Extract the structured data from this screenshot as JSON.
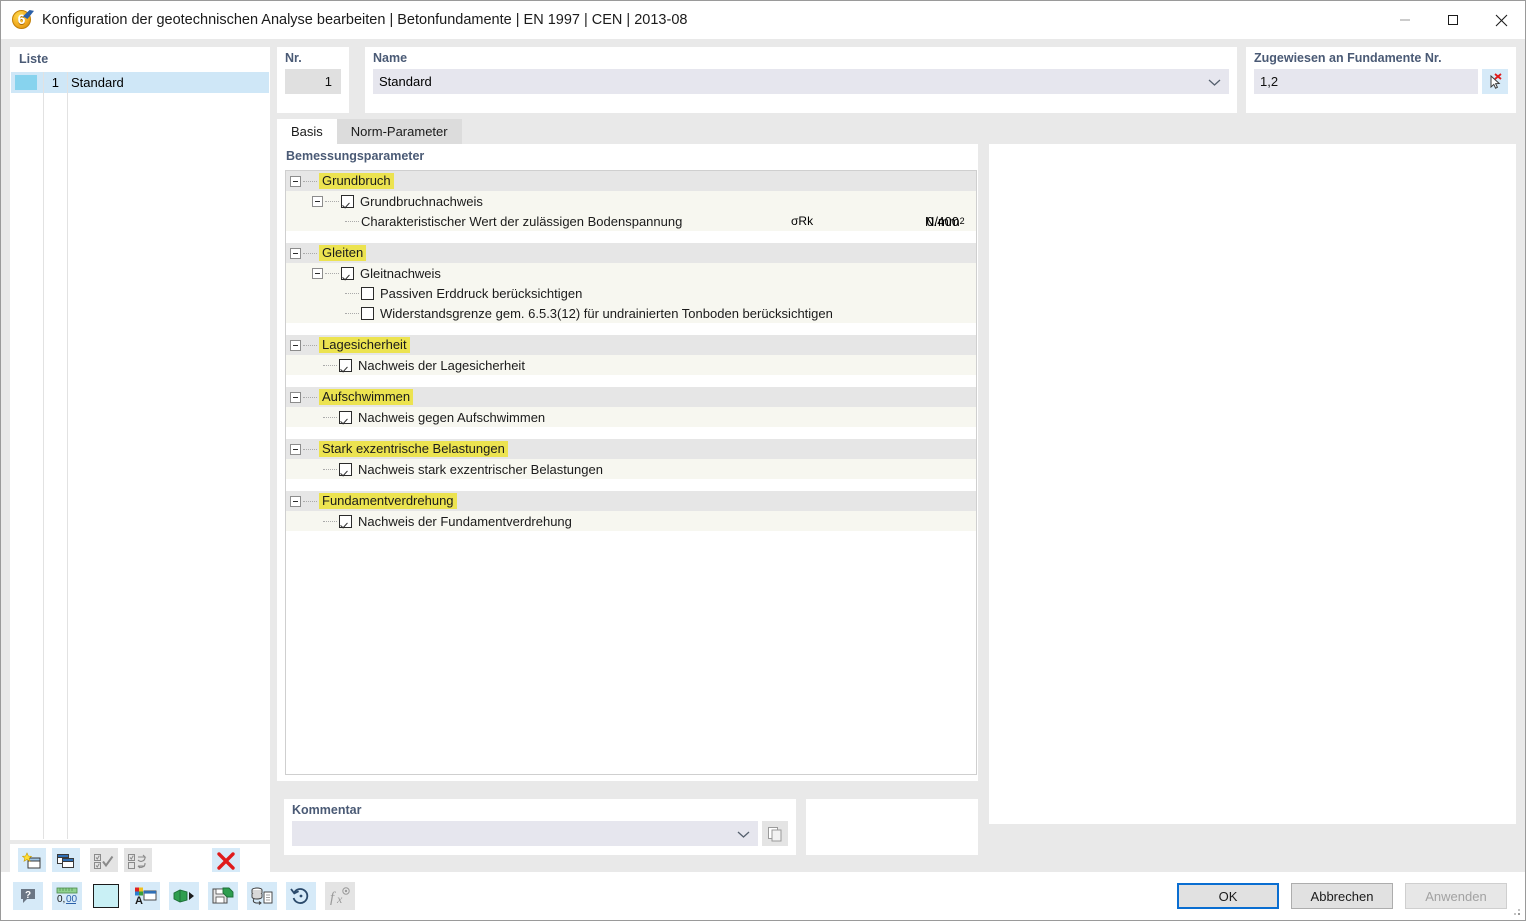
{
  "window": {
    "title": "Konfiguration der geotechnischen Analyse bearbeiten | Betonfundamente | EN 1997 | CEN | 2013-08",
    "app_icon": "dlubal-6-icon",
    "minimize_icon": "minimize-icon",
    "maximize_icon": "maximize-icon",
    "close_icon": "close-icon"
  },
  "list": {
    "caption": "Liste",
    "rows": [
      {
        "index": "1",
        "name": "Standard",
        "selected": true,
        "color": "#87d3ee"
      }
    ],
    "toolbar": [
      {
        "name": "new-configuration-button",
        "icon": "new-window-star-icon",
        "enabled": true
      },
      {
        "name": "duplicate-configuration-button",
        "icon": "copy-window-icon",
        "enabled": true
      },
      {
        "name": "select-all-button",
        "icon": "check-all-icon",
        "enabled": false
      },
      {
        "name": "invert-selection-button",
        "icon": "toggle-check-icon",
        "enabled": false
      },
      {
        "name": "delete-configuration-button",
        "icon": "red-x-icon",
        "enabled": true
      }
    ]
  },
  "header": {
    "nr_label": "Nr.",
    "nr_value": "1",
    "name_label": "Name",
    "name_value": "Standard",
    "assigned_label": "Zugewiesen an Fundamente Nr.",
    "assigned_value": "1,2",
    "pick_button_icon": "select-pointer-deselect-icon"
  },
  "tabs": [
    {
      "label": "Basis",
      "active": true
    },
    {
      "label": "Norm-Parameter",
      "active": false
    }
  ],
  "detail": {
    "caption": "Bemessungsparameter",
    "columns": {
      "symbol": "",
      "value": "",
      "unit": ""
    },
    "groups": [
      {
        "label": "Grundbruch",
        "expanded": true,
        "items": [
          {
            "label": "Grundbruchnachweis",
            "type": "checkbox",
            "checked": true,
            "expandable": true,
            "level": 1,
            "symbol": "",
            "value": "",
            "unit": ""
          },
          {
            "label": "Charakteristischer Wert der zulässigen Bodenspannung",
            "type": "value",
            "level": 2,
            "symbol": "σRk",
            "value": "0.400",
            "unit": "N/mm",
            "unit_exp": "2"
          }
        ]
      },
      {
        "label": "Gleiten",
        "expanded": true,
        "items": [
          {
            "label": "Gleitnachweis",
            "type": "checkbox",
            "checked": true,
            "expandable": true,
            "level": 1,
            "symbol": "",
            "value": "",
            "unit": ""
          },
          {
            "label": "Passiven Erddruck berücksichtigen",
            "type": "checkbox",
            "checked": false,
            "level": 2,
            "symbol": "",
            "value": "",
            "unit": ""
          },
          {
            "label": "Widerstandsgrenze gem. 6.5.3(12) für undrainierten Tonboden berücksichtigen",
            "type": "checkbox",
            "checked": false,
            "level": 2,
            "symbol": "",
            "value": "",
            "unit": ""
          }
        ]
      },
      {
        "label": "Lagesicherheit",
        "expanded": true,
        "items": [
          {
            "label": "Nachweis der Lagesicherheit",
            "type": "checkbox",
            "checked": true,
            "level": 1,
            "symbol": "",
            "value": "",
            "unit": ""
          }
        ]
      },
      {
        "label": "Aufschwimmen",
        "expanded": true,
        "items": [
          {
            "label": "Nachweis gegen Aufschwimmen",
            "type": "checkbox",
            "checked": true,
            "level": 1,
            "symbol": "",
            "value": "",
            "unit": ""
          }
        ]
      },
      {
        "label": "Stark exzentrische Belastungen",
        "expanded": true,
        "items": [
          {
            "label": "Nachweis stark exzentrischer Belastungen",
            "type": "checkbox",
            "checked": true,
            "level": 1,
            "symbol": "",
            "value": "",
            "unit": ""
          }
        ]
      },
      {
        "label": "Fundamentverdrehung",
        "expanded": true,
        "items": [
          {
            "label": "Nachweis der Fundamentverdrehung",
            "type": "checkbox",
            "checked": true,
            "level": 1,
            "symbol": "",
            "value": "",
            "unit": ""
          }
        ]
      }
    ]
  },
  "comment": {
    "label": "Kommentar",
    "value": "",
    "placeholder": "",
    "button_icon": "copy-pages-icon"
  },
  "statusbar": {
    "tools": [
      {
        "name": "help-button",
        "icon": "question-balloon-icon",
        "enabled": true
      },
      {
        "name": "decimal-places-button",
        "icon": "number-format-icon",
        "enabled": true
      },
      {
        "name": "color-swatch-button",
        "icon": "color-swatch-icon",
        "enabled": true,
        "color": "#c9f0f5"
      },
      {
        "name": "display-properties-button",
        "icon": "palette-label-icon",
        "enabled": true
      },
      {
        "name": "import-button",
        "icon": "green-box-arrow-icon",
        "enabled": true
      },
      {
        "name": "save-as-button",
        "icon": "green-floppy-icon",
        "enabled": true
      },
      {
        "name": "database-to-document-button",
        "icon": "database-transfer-icon",
        "enabled": true
      },
      {
        "name": "reset-button",
        "icon": "undo-circle-icon",
        "enabled": true
      },
      {
        "name": "formula-button",
        "icon": "fx-icon",
        "enabled": false
      }
    ],
    "buttons": [
      {
        "label": "OK",
        "name": "ok-button",
        "default": true,
        "enabled": true
      },
      {
        "label": "Abbrechen",
        "name": "cancel-button",
        "default": false,
        "enabled": true
      },
      {
        "label": "Anwenden",
        "name": "apply-button",
        "default": false,
        "enabled": false
      }
    ]
  },
  "colors": {
    "highlight_yellow": "#ece350",
    "selection_blue": "#cfe7f7",
    "accent_blue": "#0a6ed1",
    "label_blue": "#4a5a75",
    "window_bg": "#e9e9e9"
  }
}
